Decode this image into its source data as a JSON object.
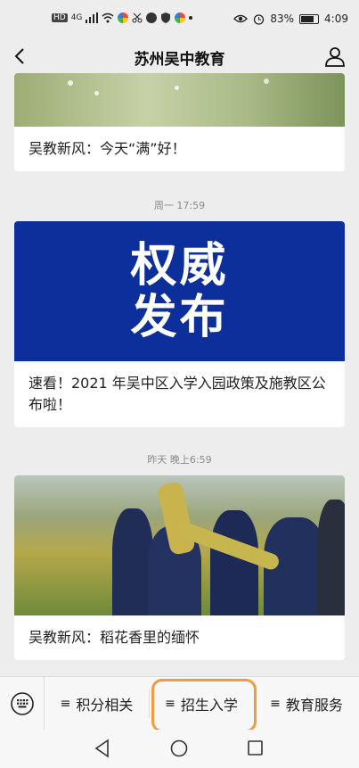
{
  "status_bar": {
    "left_icons": [
      "HD",
      "4G"
    ],
    "battery": "83%",
    "battery_level": 0.83,
    "time": "4:09"
  },
  "navbar": {
    "title": "苏州吴中教育"
  },
  "feed": [
    {
      "time": "",
      "image_text": [],
      "caption": "吴教新风：今天“满”好！"
    },
    {
      "time": "周一 17:59",
      "image_text": [
        "权威",
        "发布"
      ],
      "caption": "速看！2021 年吴中区入学入园政策及施教区公布啦！"
    },
    {
      "time": "昨天 晚上6:59",
      "image_text": [],
      "caption": "吴教新风：稻花香里的缅怀"
    }
  ],
  "menu": {
    "items": [
      {
        "icon": "menu-lines-icon",
        "label": "积分相关"
      },
      {
        "icon": "menu-lines-icon",
        "label": "招生入学"
      },
      {
        "icon": "menu-lines-icon",
        "label": "教育服务"
      }
    ],
    "highlighted": "招生入学",
    "highlight_color": "#f39a3e"
  },
  "colors": {
    "page_bg": "#ededed",
    "banner_blue": "#0d2f9c"
  }
}
